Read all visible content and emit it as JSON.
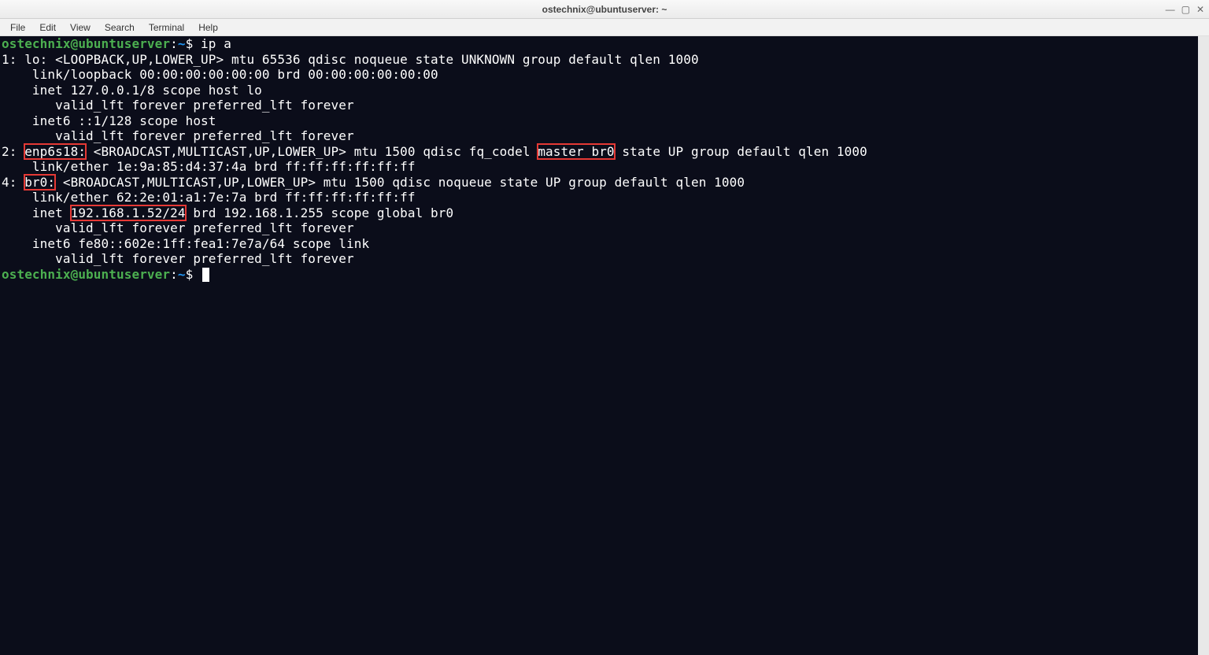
{
  "window": {
    "title": "ostechnix@ubuntuserver: ~",
    "controls": {
      "minimize": "—",
      "maximize": "▢",
      "close": "✕"
    }
  },
  "menu": {
    "file": "File",
    "edit": "Edit",
    "view": "View",
    "search": "Search",
    "terminal": "Terminal",
    "help": "Help"
  },
  "prompt": {
    "userhost": "ostechnix@ubuntuserver",
    "colon": ":",
    "path": "~",
    "dollar": "$"
  },
  "commands": {
    "ip_a": " ip a"
  },
  "output": {
    "l1": "1: lo: <LOOPBACK,UP,LOWER_UP> mtu 65536 qdisc noqueue state UNKNOWN group default qlen 1000",
    "l2": "    link/loopback 00:00:00:00:00:00 brd 00:00:00:00:00:00",
    "l3": "    inet 127.0.0.1/8 scope host lo",
    "l4": "       valid_lft forever preferred_lft forever",
    "l5": "    inet6 ::1/128 scope host",
    "l6": "       valid_lft forever preferred_lft forever",
    "l7a": "2: ",
    "l7b": "enp6s18:",
    "l7c": " <BROADCAST,MULTICAST,UP,LOWER_UP> mtu 1500 qdisc fq_codel ",
    "l7d": "master br0",
    "l7e": " state UP group default qlen 1000",
    "l8": "    link/ether 1e:9a:85:d4:37:4a brd ff:ff:ff:ff:ff:ff",
    "l9a": "4: ",
    "l9b": "br0:",
    "l9c": " <BROADCAST,MULTICAST,UP,LOWER_UP> mtu 1500 qdisc noqueue state UP group default qlen 1000",
    "l10": "    link/ether 62:2e:01:a1:7e:7a brd ff:ff:ff:ff:ff:ff",
    "l11a": "    inet ",
    "l11b": "192.168.1.52/24",
    "l11c": " brd 192.168.1.255 scope global br0",
    "l12": "       valid_lft forever preferred_lft forever",
    "l13": "    inet6 fe80::602e:1ff:fea1:7e7a/64 scope link",
    "l14": "       valid_lft forever preferred_lft forever"
  },
  "highlights": {
    "iface1": "enp6s18:",
    "master": "master br0",
    "iface2": "br0:",
    "ip": "192.168.1.52/24"
  },
  "colors": {
    "bg": "#0b0d1a",
    "fg": "#ffffff",
    "user": "#4caf50",
    "path": "#2196f3",
    "highlight": "#e53935"
  }
}
